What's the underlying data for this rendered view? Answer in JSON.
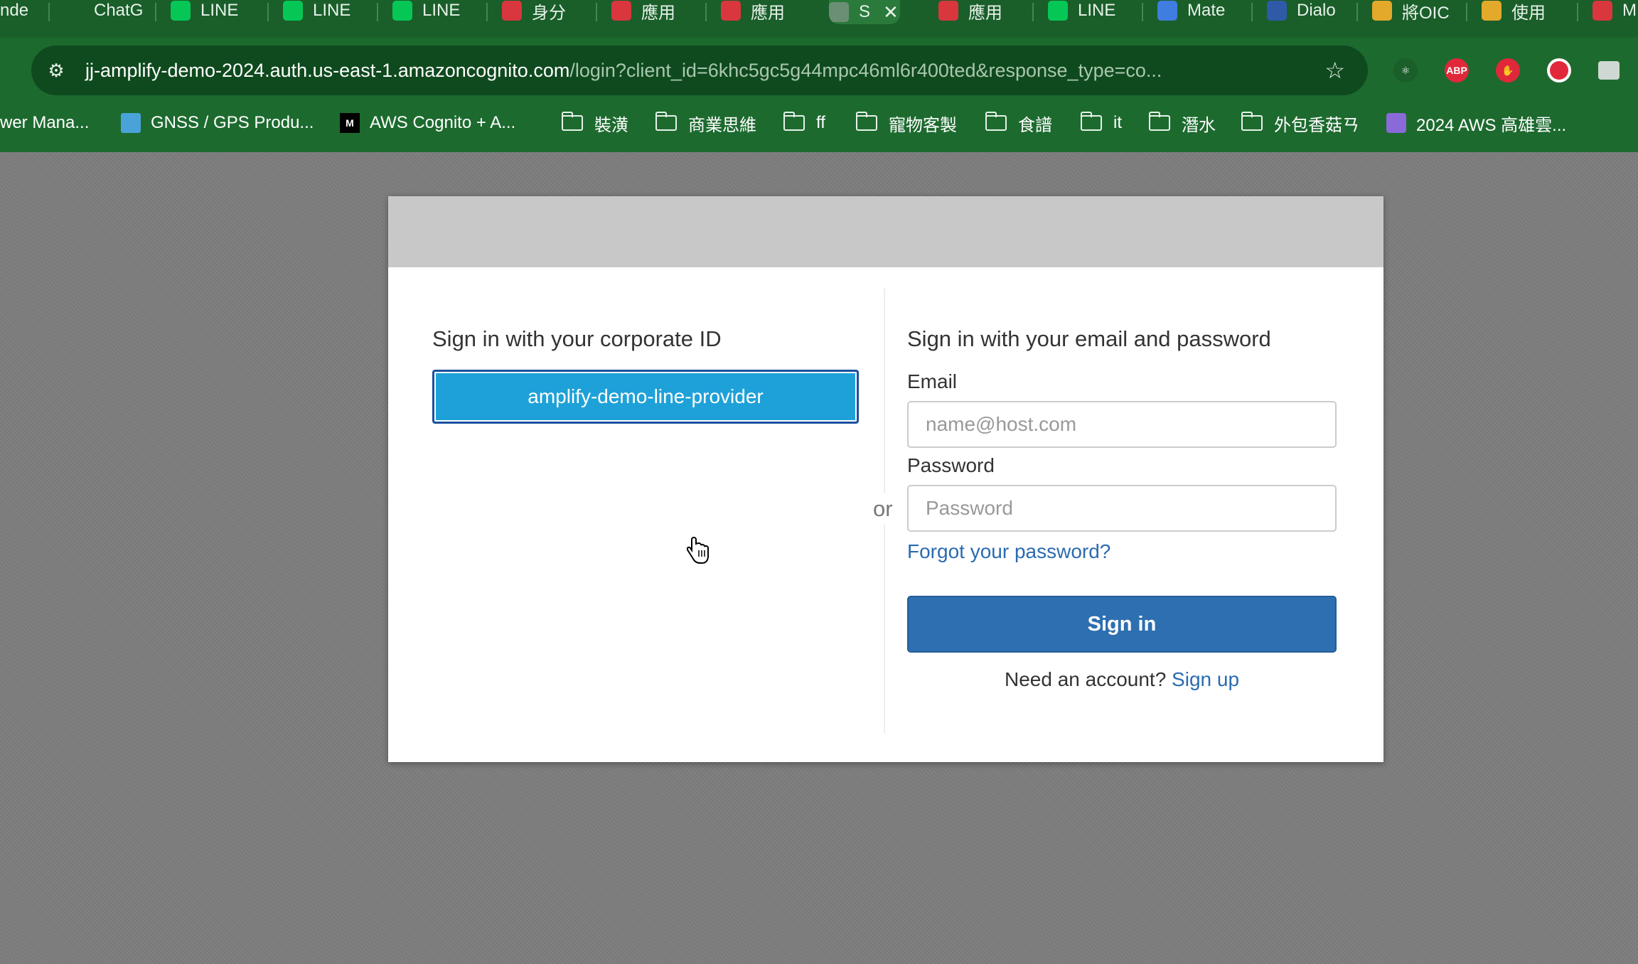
{
  "browser": {
    "tabs": [
      {
        "label": "nde",
        "icon": "tab-favicon-generic",
        "color": "#5a8f66"
      },
      {
        "label": "ChatG",
        "icon": "chatgpt-icon",
        "color": "#1a5e2a"
      },
      {
        "label": "LINE",
        "icon": "code-icon",
        "color": "#06c755"
      },
      {
        "label": "LINE",
        "icon": "line-icon",
        "color": "#06c755"
      },
      {
        "label": "LINE",
        "icon": "line-icon",
        "color": "#06c755"
      },
      {
        "label": "身分",
        "icon": "document-icon",
        "color": "#d9363e"
      },
      {
        "label": "應用",
        "icon": "warning-icon",
        "color": "#d9363e"
      },
      {
        "label": "應用",
        "icon": "document-icon",
        "color": "#d9363e"
      },
      {
        "label": "S",
        "icon": "globe-icon",
        "color": "#6b8f74",
        "active": true
      },
      {
        "label": "應用",
        "icon": "document-icon",
        "color": "#d9363e"
      },
      {
        "label": "LINE",
        "icon": "line-chat-icon",
        "color": "#06c755"
      },
      {
        "label": "Mate",
        "icon": "material-icon",
        "color": "#3f7de0"
      },
      {
        "label": "Dialo",
        "icon": "dialog-icon",
        "color": "#2f5aa8"
      },
      {
        "label": "將OIC",
        "icon": "box-icon",
        "color": "#e3a92b"
      },
      {
        "label": "使用",
        "icon": "box-icon",
        "color": "#e3a92b"
      },
      {
        "label": "M",
        "icon": "cloud-icon",
        "color": "#d9363e"
      }
    ],
    "close_glyph": "✕",
    "url_host": "jj-amplify-demo-2024.auth.us-east-1.amazoncognito.com",
    "url_rest": "/login?client_id=6khc5gc5g44mpc46ml6r400ted&response_type=co...",
    "extensions": [
      {
        "name": "react-devtools-icon",
        "label": "⚛",
        "color": "#1a5e2a"
      },
      {
        "name": "adblock-plus-icon",
        "label": "ABP",
        "color": "#e0283a"
      },
      {
        "name": "hand-stop-icon",
        "label": "✋",
        "color": "#e0283a"
      },
      {
        "name": "record-icon",
        "label": "",
        "color": "#e0283a"
      },
      {
        "name": "window-icon",
        "label": "",
        "color": "#cfd8d2"
      }
    ],
    "bookmarks": [
      {
        "label": "wer Mana...",
        "type": "text"
      },
      {
        "label": "GNSS / GPS Produ...",
        "type": "site",
        "icon": "gnss-icon"
      },
      {
        "label": "AWS Cognito + A...",
        "type": "site",
        "icon": "medium-icon"
      },
      {
        "label": "裝潢",
        "type": "folder"
      },
      {
        "label": "商業思維",
        "type": "folder"
      },
      {
        "label": "ff",
        "type": "folder"
      },
      {
        "label": "寵物客製",
        "type": "folder"
      },
      {
        "label": "食譜",
        "type": "folder"
      },
      {
        "label": "it",
        "type": "folder"
      },
      {
        "label": "潛水",
        "type": "folder"
      },
      {
        "label": "外包香菇ㄢ",
        "type": "folder"
      },
      {
        "label": "2024 AWS 高雄雲...",
        "type": "site",
        "icon": "aws-cube-icon"
      }
    ]
  },
  "login": {
    "corporate_heading": "Sign in with your corporate ID",
    "idp_button_label": "amplify-demo-line-provider",
    "or_label": "or",
    "email_heading": "Sign in with your email and password",
    "email_label": "Email",
    "email_placeholder": "name@host.com",
    "email_value": "",
    "password_label": "Password",
    "password_placeholder": "Password",
    "password_value": "",
    "forgot_link": "Forgot your password?",
    "signin_button": "Sign in",
    "need_account_text": "Need an account?",
    "signup_link": "Sign up"
  },
  "colors": {
    "chrome_green": "#1d6a2f",
    "idp_button": "#1ea1d9",
    "signin_button": "#2d6fb0",
    "link": "#2a6bb0"
  }
}
